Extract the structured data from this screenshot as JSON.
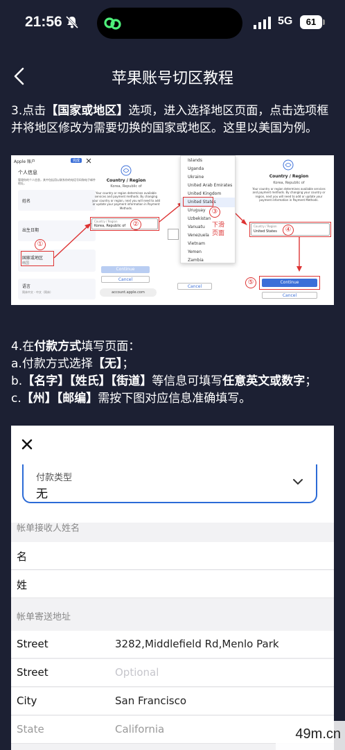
{
  "status_bar": {
    "time": "21:56",
    "network": "5G",
    "battery": "61"
  },
  "nav": {
    "title": "苹果账号切区教程"
  },
  "step3": {
    "prefix": "3.点击",
    "hl": "【国家或地区】",
    "text": "选项，进入选择地区页面，点击选项框并将地区修改为需要切换的国家或地区。这里以美国为例。"
  },
  "shot1": {
    "account_title": "Apple 账户",
    "account_badge": "完成",
    "section": "个人信息",
    "section_desc": "管理你的个人信息，其中包括用以联系你的电话号码和电子邮件地址。",
    "row_name": "姓名",
    "row_birth": "出生日期",
    "row_region": "国家或地区",
    "row_region_val": "韩国",
    "row_lang": "语言",
    "row_lang_val": "简体中文 - 中文（简体）",
    "dialog_title": "Country / Region",
    "dialog_current": "Korea, Republic of",
    "dialog_desc": "Your country or region determines available services and payment methods. By changing your country or region, next you will need to add or update your payment information in Payment Methods.",
    "field_label": "Country / Region",
    "field_value_kr": "Korea, Republic of",
    "field_value_us": "United States",
    "continue": "Continue",
    "cancel": "Cancel",
    "url": "account.apple.com",
    "countries": [
      "Islands",
      "Uganda",
      "Ukraine",
      "United Arab Emirates",
      "United Kingdom",
      "United States",
      "Uruguay",
      "Uzbekistan",
      "Vanuatu",
      "Venezuela",
      "Vietnam",
      "Yemen",
      "Zambia"
    ],
    "swipe_note_1": "下滑",
    "swipe_note_2": "页面",
    "marks": [
      "①",
      "②",
      "③",
      "④",
      "⑤"
    ]
  },
  "step4": {
    "line1_a": "4.在",
    "line1_hl": "付款方式",
    "line1_b": "填写页面：",
    "line2_a": "a.付款方式选择",
    "line2_hl": "【无】",
    "line2_b": "；",
    "line3_a": "b.",
    "line3_hl1": "【名字】【姓氏】【街道】",
    "line3_b": "等信息可填写",
    "line3_hl2": "任意英文或数字",
    "line3_c": "；",
    "line4_a": "c.",
    "line4_hl": "【州】【邮编】",
    "line4_b": "需按下图对应信息准确填写。"
  },
  "payment": {
    "type_label": "付款类型",
    "type_value": "无",
    "name_header": "帐单接收人姓名",
    "first_name": "名",
    "last_name": "姓",
    "address_header": "帐单寄送地址",
    "rows": [
      {
        "label": "Street",
        "value": "3282,Middlefield Rd,Menlo Park"
      },
      {
        "label": "Street",
        "placeholder": "Optional"
      },
      {
        "label": "City",
        "value": "San Francisco"
      },
      {
        "label": "State",
        "value": "California"
      }
    ]
  },
  "watermark": "49m.cn"
}
